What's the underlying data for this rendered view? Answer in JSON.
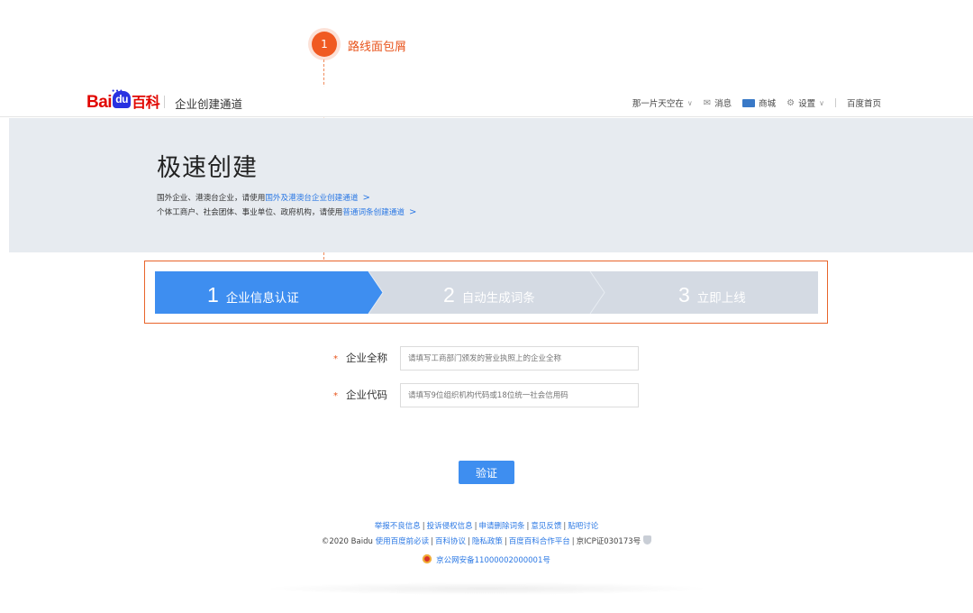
{
  "annotation": {
    "number": "1",
    "label": "路线面包屑"
  },
  "header": {
    "logo": {
      "bai": "Bai",
      "du": "du",
      "baike": "百科"
    },
    "title": "企业创建通道",
    "nav": {
      "user": "那一片天空在",
      "messages": "消息",
      "mall": "商城",
      "settings": "设置",
      "home": "百度首页"
    }
  },
  "banner": {
    "title": "极速创建",
    "line1": {
      "prefix": "国外企业、港澳台企业，请使用",
      "link": "国外及港澳台企业创建通道",
      "arrow": ">"
    },
    "line2": {
      "prefix": "个体工商户、社会团体、事业单位、政府机构，请使用",
      "link": "普通词条创建通道",
      "arrow": ">"
    }
  },
  "steps": [
    {
      "num": "1",
      "label": "企业信息认证",
      "active": true
    },
    {
      "num": "2",
      "label": "自动生成词条",
      "active": false
    },
    {
      "num": "3",
      "label": "立即上线",
      "active": false
    }
  ],
  "colors": {
    "active_step": "#3e8ef0",
    "inactive_step": "#d4dae3",
    "accent": "#e8541c",
    "link": "#2b78e4"
  },
  "form": {
    "required_mark": "*",
    "name_label": "企业全称",
    "name_placeholder": "请填写工商部门颁发的营业执照上的企业全称",
    "code_label": "企业代码",
    "code_placeholder": "请填写9位组织机构代码或18位统一社会信用码",
    "submit": "验证"
  },
  "footer": {
    "links1": [
      "举报不良信息",
      "投诉侵权信息",
      "申请删除词条",
      "意见反馈",
      "贴吧讨论"
    ],
    "copyright": "©2020 Baidu",
    "links2": [
      "使用百度前必读",
      "百科协议",
      "隐私政策",
      "百度百科合作平台"
    ],
    "icp": "京ICP证030173号",
    "police": "京公网安备11000002000001号"
  }
}
